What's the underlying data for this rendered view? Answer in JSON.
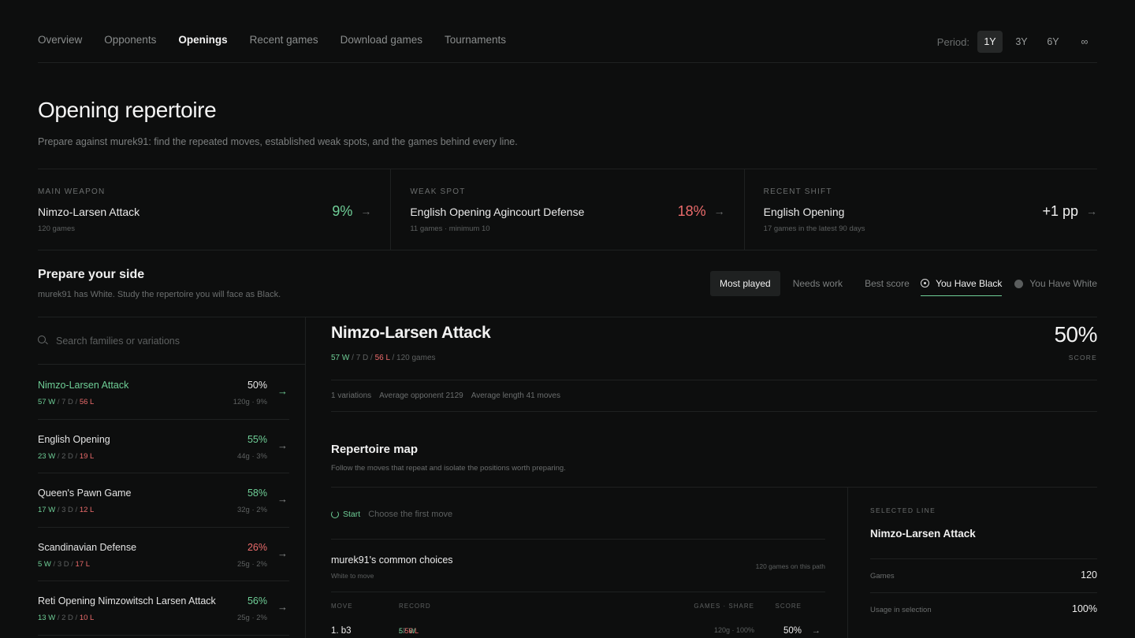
{
  "nav": {
    "tabs": [
      {
        "label": "Overview"
      },
      {
        "label": "Opponents"
      },
      {
        "label": "Openings"
      },
      {
        "label": "Recent games"
      },
      {
        "label": "Download games"
      },
      {
        "label": "Tournaments"
      }
    ],
    "active_tab": "Openings",
    "period_label": "Period:",
    "periods": [
      "1Y",
      "3Y",
      "6Y",
      "∞"
    ],
    "active_period": "1Y"
  },
  "header": {
    "title": "Opening repertoire",
    "subtitle": "Prepare against murek91: find the repeated moves, established weak spots, and the games behind every line."
  },
  "stats": [
    {
      "label": "MAIN WEAPON",
      "name": "Nimzo-Larsen Attack",
      "note": "120 games",
      "value": "9%",
      "color": "#6fcf97"
    },
    {
      "label": "WEAK SPOT",
      "name": "English Opening Agincourt Defense",
      "note": "11 games · minimum 10",
      "value": "18%",
      "color": "#eb6b6b"
    },
    {
      "label": "RECENT SHIFT",
      "name": "English Opening",
      "note": "17 games in the latest 90 days",
      "value": "+1 pp",
      "color": "#f0f0f0"
    }
  ],
  "prepare": {
    "title": "Prepare your side",
    "subtitle": "murek91 has White. Study the repertoire you will face as Black.",
    "sort_tabs": [
      "Most played",
      "Needs work",
      "Best score"
    ],
    "active_sort": "Most played",
    "sides": [
      "You Have Black",
      "You Have White"
    ],
    "active_side": "You Have Black"
  },
  "search": {
    "placeholder": "Search families or variations"
  },
  "openings": [
    {
      "name": "Nimzo-Larsen Attack",
      "w": "57 W",
      "d": "7 D",
      "l": "56 L",
      "pct": "50%",
      "pct_color": "#e8e8e8",
      "meta": "120g · 9%",
      "selected": true
    },
    {
      "name": "English Opening",
      "w": "23 W",
      "d": "2 D",
      "l": "19 L",
      "pct": "55%",
      "pct_color": "#6fcf97",
      "meta": "44g · 3%"
    },
    {
      "name": "Queen's Pawn Game",
      "w": "17 W",
      "d": "3 D",
      "l": "12 L",
      "pct": "58%",
      "pct_color": "#6fcf97",
      "meta": "32g · 2%"
    },
    {
      "name": "Scandinavian Defense",
      "w": "5 W",
      "d": "3 D",
      "l": "17 L",
      "pct": "26%",
      "pct_color": "#eb6b6b",
      "meta": "25g · 2%"
    },
    {
      "name": "Reti Opening Nimzowitsch Larsen Attack",
      "w": "13 W",
      "d": "2 D",
      "l": "10 L",
      "pct": "56%",
      "pct_color": "#6fcf97",
      "meta": "25g · 2%"
    }
  ],
  "detail": {
    "title": "Nimzo-Larsen Attack",
    "w": "57 W",
    "d": "7 D",
    "l": "56 L",
    "games": "120 games",
    "score": "50%",
    "score_label": "SCORE",
    "meta": [
      "1 variations",
      "Average opponent 2129",
      "Average length 41 moves"
    ],
    "map_title": "Repertoire map",
    "map_subtitle": "Follow the moves that repeat and isolate the positions worth preparing.",
    "start_label": "Start",
    "start_hint": "Choose the first move",
    "choices_title": "murek91's common choices",
    "choices_sub": "White to move",
    "choices_count": "120 games on this path",
    "table_headers": {
      "move": "MOVE",
      "record": "RECORD",
      "games": "GAMES · SHARE",
      "score": "SCORE"
    },
    "move_row": {
      "move": "1. b3",
      "w": "57 W",
      "d": "7 D",
      "l": "56 L",
      "games": "120g · 100%",
      "score": "50%"
    }
  },
  "selected_line": {
    "label": "SELECTED LINE",
    "name": "Nimzo-Larsen Attack",
    "rows": [
      {
        "k": "Games",
        "v": "120"
      },
      {
        "k": "Usage in selection",
        "v": "100%"
      }
    ]
  },
  "icons": {
    "stat_arrow": "arrow-right-icon",
    "search": "search-icon",
    "restart": "restart-icon"
  }
}
